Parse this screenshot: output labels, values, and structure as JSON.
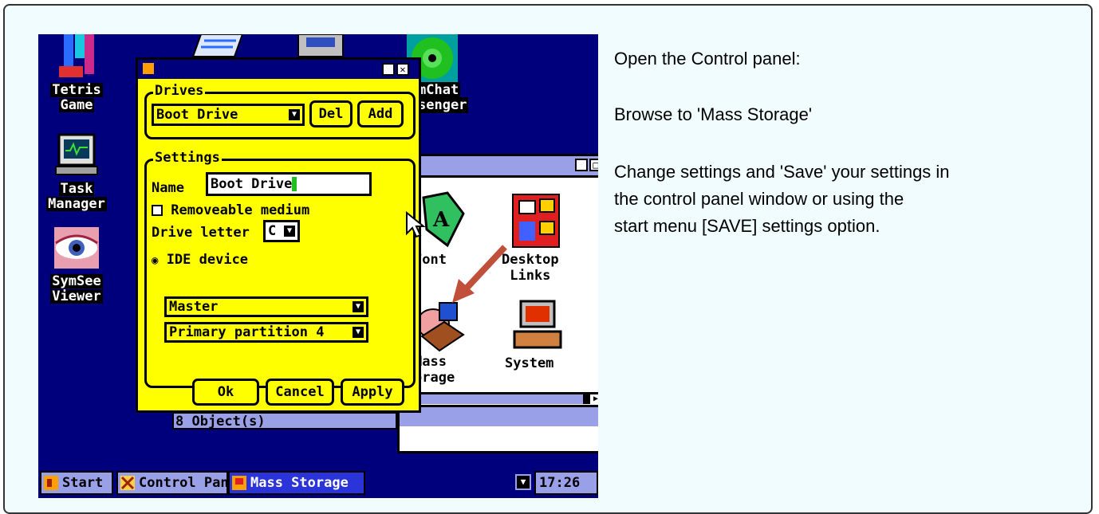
{
  "instructions": [
    "Open the Control panel:",
    "Browse to 'Mass Storage'",
    "Change settings and 'Save' your settings in",
    "the control panel window or using the",
    "start menu [SAVE] settings option."
  ],
  "desktop": {
    "icons": [
      {
        "line1": "Tetris",
        "line2": "Game"
      },
      {
        "line1": "Task",
        "line2": "Manager"
      },
      {
        "line1": "SymSee",
        "line2": "Viewer"
      },
      {
        "line1": "mChat",
        "line2": "senger"
      }
    ]
  },
  "control_panel": {
    "items": [
      "Font",
      "Desktop",
      "Links",
      "Mass",
      "orage",
      "System"
    ],
    "status": "8 Object(s)"
  },
  "dialog": {
    "drives_title": "Drives",
    "drive_select": "Boot Drive",
    "del_label": "Del",
    "add_label": "Add",
    "settings_title": "Settings",
    "name_label": "Name",
    "name_value": "Boot Drive",
    "removable_label": "Removeable medium",
    "drive_letter_label": "Drive letter",
    "drive_letter_value": "C",
    "ide_label": "IDE device",
    "master_value": "Master",
    "partition_value": "Primary partition 4",
    "ok_label": "Ok",
    "cancel_label": "Cancel",
    "apply_label": "Apply"
  },
  "taskbar": {
    "start_label": "Start",
    "task1_label": "Control Pane",
    "task2_label": "Mass Storage",
    "clock": "17:26"
  },
  "colors": {
    "desktop": "#00007c",
    "dialog": "#ffff00",
    "window_title": "#9aa0e8",
    "arrow": "#c0503a"
  }
}
